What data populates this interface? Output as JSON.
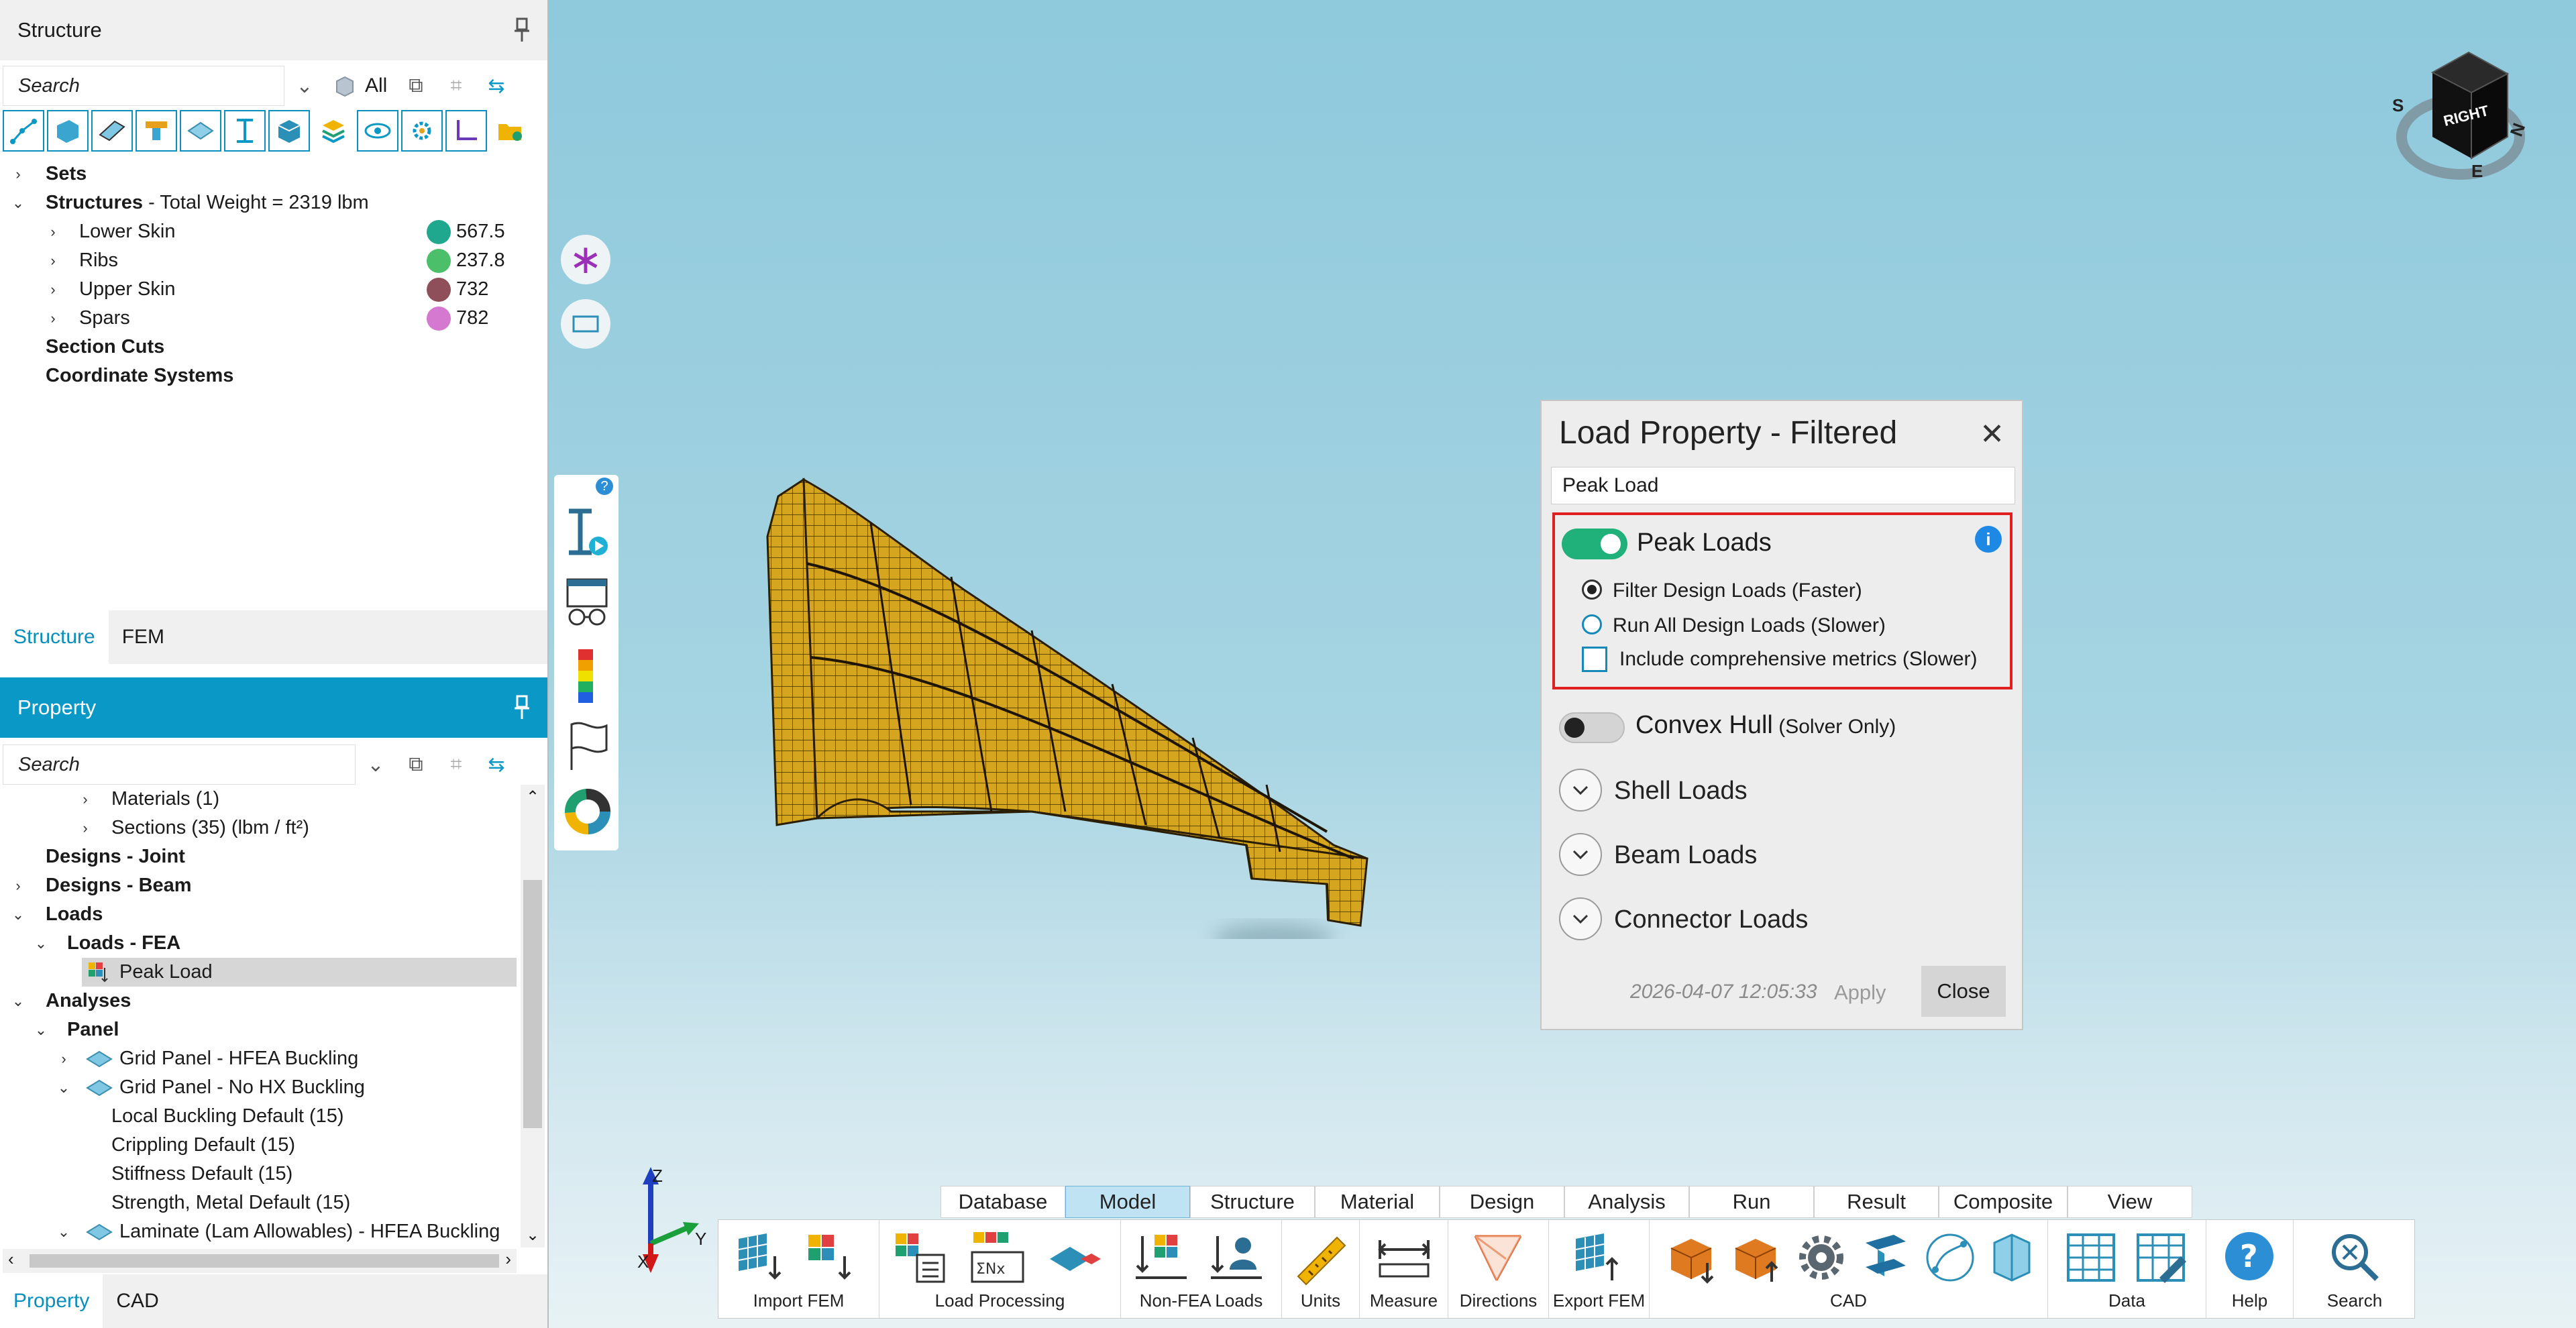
{
  "structure_panel": {
    "title": "Structure",
    "search_placeholder": "Search",
    "filter_label": "All",
    "tree": [
      {
        "label": "Sets"
      },
      {
        "label": "Structures",
        "suffix": " - Total Weight = 2319 lbm"
      },
      {
        "label": "Lower Skin",
        "value": "567.5",
        "color": "#1fa88e"
      },
      {
        "label": "Ribs",
        "value": "237.8",
        "color": "#4cbf6a"
      },
      {
        "label": "Upper Skin",
        "value": "732",
        "color": "#8e4f5a"
      },
      {
        "label": "Spars",
        "value": "782",
        "color": "#d478d0"
      },
      {
        "label": "Section Cuts"
      },
      {
        "label": "Coordinate Systems"
      }
    ],
    "tabs": [
      "Structure",
      "FEM"
    ]
  },
  "property_panel": {
    "title": "Property",
    "search_placeholder": "Search",
    "tree": [
      {
        "label": "Materials (1)"
      },
      {
        "label": "Sections (35) (lbm / ft²)"
      },
      {
        "label": "Designs - Joint"
      },
      {
        "label": "Designs - Beam"
      },
      {
        "label": "Loads"
      },
      {
        "label": "Loads - FEA"
      },
      {
        "label": "Peak Load"
      },
      {
        "label": "Analyses"
      },
      {
        "label": "Panel"
      },
      {
        "label": "Grid Panel - HFEA Buckling"
      },
      {
        "label": "Grid Panel - No HX Buckling"
      },
      {
        "label": "Local Buckling Default (15)"
      },
      {
        "label": "Crippling Default (15)"
      },
      {
        "label": "Stiffness Default (15)"
      },
      {
        "label": "Strength, Metal Default (15)"
      },
      {
        "label": "Laminate (Lam Allowables) - HFEA Buckling"
      }
    ],
    "tabs": [
      "Property",
      "CAD"
    ]
  },
  "dialog": {
    "title": "Load Property - Filtered",
    "name_value": "Peak Load",
    "peak_loads": {
      "label": "Peak Loads",
      "enabled": true,
      "options": [
        "Filter Design Loads (Faster)",
        "Run All Design Loads (Slower)"
      ],
      "selected": "Filter Design Loads (Faster)",
      "checkbox_label": "Include comprehensive metrics (Slower)",
      "checkbox_checked": false
    },
    "convex_hull": {
      "label": "Convex Hull",
      "note": "(Solver Only)",
      "enabled": false
    },
    "sections": [
      "Shell Loads",
      "Beam Loads",
      "Connector Loads"
    ],
    "timestamp": "2026-04-07 12:05:33",
    "apply_label": "Apply",
    "close_label": "Close"
  },
  "viewcube": {
    "face_label": "RIGHT",
    "compass": [
      "S",
      "N",
      "E"
    ]
  },
  "axes": {
    "x": "X",
    "y": "Y",
    "z": "Z"
  },
  "ribbon": {
    "tabs": [
      "Database",
      "Model",
      "Structure",
      "Material",
      "Design",
      "Analysis",
      "Run",
      "Result",
      "Composite",
      "View"
    ],
    "active_tab": "Model",
    "groups": [
      "Import FEM",
      "Load Processing",
      "Non-FEA Loads",
      "Units",
      "Measure",
      "Directions",
      "Export FEM",
      "CAD",
      "Data",
      "Help",
      "Search"
    ]
  },
  "colors": {
    "accent": "#0a99c6",
    "mesh": "#d6a520",
    "highlight": "#e02020",
    "toggle_on": "#20b07a"
  }
}
